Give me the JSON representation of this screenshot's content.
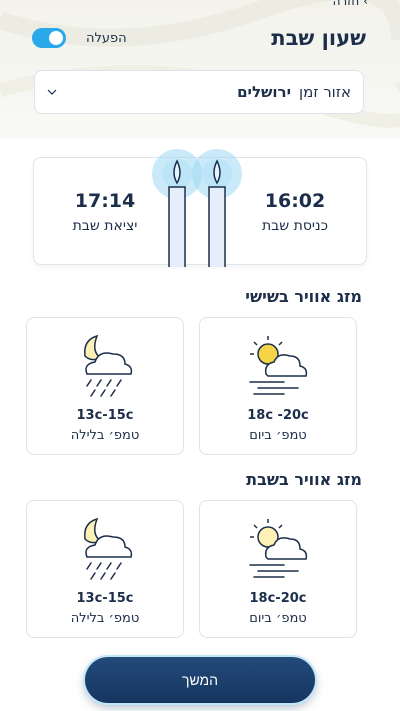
{
  "header": {
    "back_label": "חזרה",
    "title": "שעון שבת",
    "toggle_label": "הפעלה",
    "toggle_on": true
  },
  "zone": {
    "label": "אזור זמן",
    "city": "ירושלים"
  },
  "shabbat": {
    "entry_time": "16:02",
    "entry_label": "כניסת שבת",
    "exit_time": "17:14",
    "exit_label": "יציאת שבת"
  },
  "friday": {
    "title": "מזג אוויר בשישי",
    "day": {
      "temp": "18c -20c",
      "label": "טמפ׳ ביום",
      "icon": "sun-cloud-wind-icon"
    },
    "night": {
      "temp": "13c-15c",
      "label": "טמפ׳ בלילה",
      "icon": "moon-cloud-rain-icon"
    }
  },
  "saturday": {
    "title": "מזג אוויר בשבת",
    "day": {
      "temp": "18c-20c",
      "label": "טמפ׳ ביום",
      "icon": "sun-cloud-wind-icon"
    },
    "night": {
      "temp": "13c-15c",
      "label": "טמפ׳ בלילה",
      "icon": "moon-cloud-rain-icon"
    }
  },
  "continue_label": "המשך",
  "colors": {
    "primary": "#1c2e4a",
    "accent": "#29a9ea",
    "sun": "#f5d547"
  }
}
